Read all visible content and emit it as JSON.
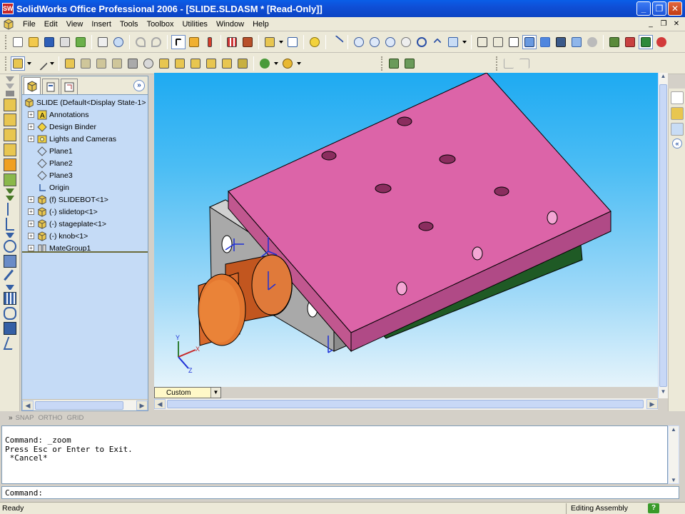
{
  "window": {
    "title": "SolidWorks Office Professional 2006 - [SLIDE.SLDASM * [Read-Only]]",
    "app_icon_text": "SW",
    "minimize": "_",
    "maximize": "❐",
    "close": "✕"
  },
  "menu": {
    "items": [
      "File",
      "Edit",
      "View",
      "Insert",
      "Tools",
      "Toolbox",
      "Utilities",
      "Window",
      "Help"
    ],
    "doc_minimize": "_",
    "doc_restore": "❐",
    "doc_close": "✕"
  },
  "feature_tree": {
    "expand_symbol": "+",
    "root": "SLIDE  (Default<Display State-1>",
    "items": [
      {
        "label": "Annotations",
        "expandable": true,
        "icon": "annotations-icon"
      },
      {
        "label": "Design Binder",
        "expandable": true,
        "icon": "design-binder-icon"
      },
      {
        "label": "Lights and Cameras",
        "expandable": true,
        "icon": "lights-icon"
      },
      {
        "label": "Plane1",
        "expandable": false,
        "icon": "plane-icon"
      },
      {
        "label": "Plane2",
        "expandable": false,
        "icon": "plane-icon"
      },
      {
        "label": "Plane3",
        "expandable": false,
        "icon": "plane-icon"
      },
      {
        "label": "Origin",
        "expandable": false,
        "icon": "origin-icon"
      },
      {
        "label": "(f) SLIDEBOT<1>",
        "expandable": true,
        "icon": "part-icon"
      },
      {
        "label": "(-) slidetop<1>",
        "expandable": true,
        "icon": "part-icon"
      },
      {
        "label": "(-) stageplate<1>",
        "expandable": true,
        "icon": "part-icon"
      },
      {
        "label": "(-) knob<1>",
        "expandable": true,
        "icon": "part-icon"
      },
      {
        "label": "MateGroup1",
        "expandable": true,
        "icon": "mategroup-icon"
      }
    ]
  },
  "viewport": {
    "view_orientation": "Custom",
    "axis_labels": {
      "x": "X",
      "y": "Y",
      "z": "Z"
    }
  },
  "snap_bar": {
    "grip": "»",
    "items": [
      "SNAP",
      "ORTHO",
      "GRID"
    ]
  },
  "command": {
    "history": [
      "Command: _zoom",
      "Press Esc or Enter to Exit.",
      " *Cancel*"
    ],
    "prompt": "Command:",
    "value": ""
  },
  "status": {
    "left": "Ready",
    "mode": "Editing Assembly",
    "help": "?"
  },
  "colors": {
    "titlebar": "#0b4fd6",
    "chrome": "#ece9d8",
    "tree_bg": "#c5dbf6",
    "viewport_top": "#1eaaf2",
    "viewport_bottom": "#e6f4fb",
    "block_top": "#dc64a8",
    "block_side": "#b04a86",
    "plate": "#a9a9a9",
    "knob": "#d9692b"
  }
}
